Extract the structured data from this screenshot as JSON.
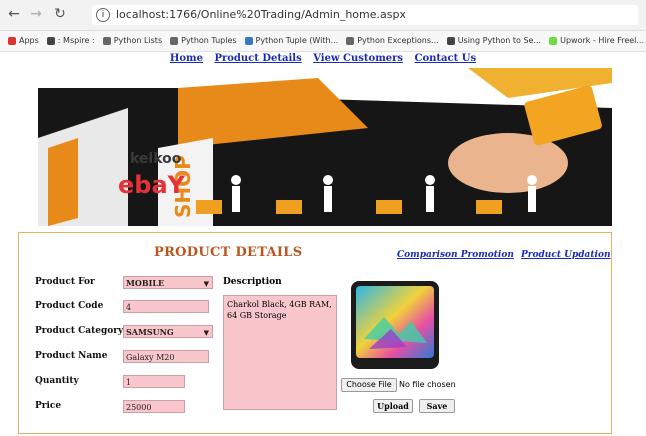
{
  "browser": {
    "url": "localhost:1766/Online%20Trading/Admin_home.aspx",
    "info_icon": "i",
    "bookmarks": [
      {
        "label": "Apps",
        "color": "#d33"
      },
      {
        "label": ": Mspire :",
        "color": "#444"
      },
      {
        "label": "Python Lists",
        "color": "#666"
      },
      {
        "label": "Python Tuples",
        "color": "#666"
      },
      {
        "label": "Python Tuple (With...",
        "color": "#3a76c4"
      },
      {
        "label": "Python Exceptions...",
        "color": "#666"
      },
      {
        "label": "Using Python to Se...",
        "color": "#444"
      },
      {
        "label": "Upwork - Hire Freel...",
        "color": "#6fda44"
      }
    ]
  },
  "nav": {
    "home": "Home",
    "product_details": "Product Details",
    "view_customers": "View Customers",
    "contact_us": "Contact Us"
  },
  "banner": {
    "shop_text": "SHOP",
    "kelkoo": "kelkoo",
    "ebay": "ebaY"
  },
  "form": {
    "title": "PRODUCT DETAILS",
    "comparison_promotion": "Comparison Promotion",
    "product_updation": "Product Updation",
    "labels": {
      "product_for": "Product For",
      "product_code": "Product Code",
      "product_category": "Product Category",
      "product_name": "Product Name",
      "quantity": "Quantity",
      "price": "Price",
      "description": "Description"
    },
    "values": {
      "product_for": "MOBILE",
      "product_code": "4",
      "product_category": "SAMSUNG",
      "product_name": "Galaxy M20",
      "quantity": "1",
      "price": "25000",
      "description": "Charkol Black, 4GB RAM, 64 GB Storage"
    },
    "caret": "▼",
    "choose_file": "Choose File",
    "no_file": "No file chosen",
    "upload": "Upload",
    "save": "Save"
  }
}
